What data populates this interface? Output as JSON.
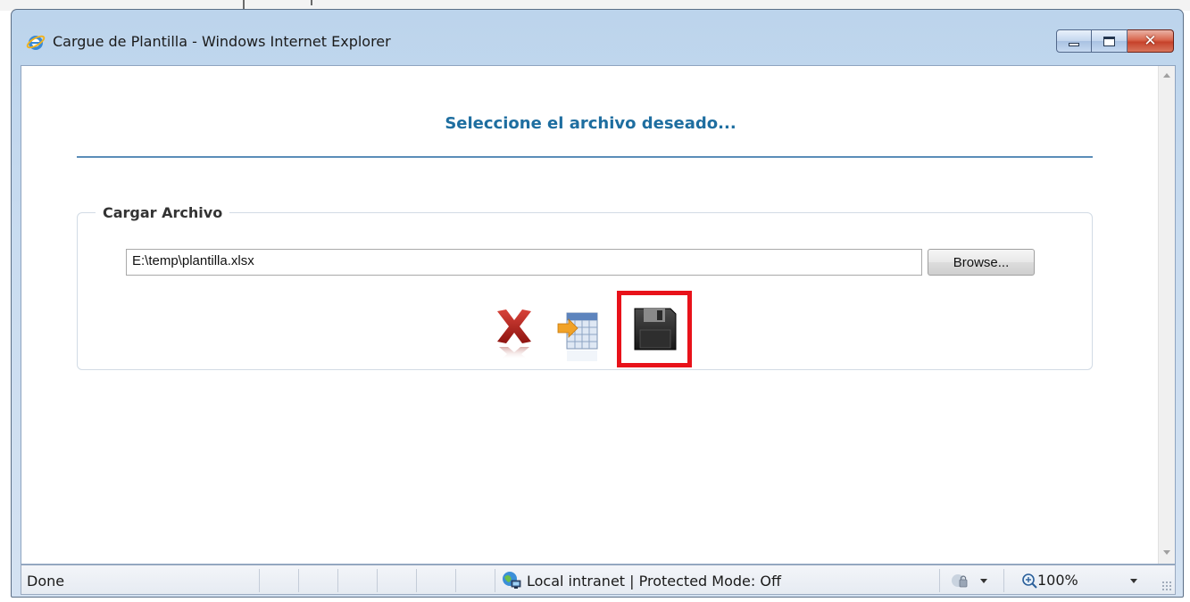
{
  "window": {
    "title": "Cargue de Plantilla - Windows Internet Explorer",
    "close_glyph": "✕"
  },
  "page": {
    "heading": "Seleccione el archivo deseado...",
    "upload_section": {
      "legend": "Cargar Archivo",
      "file_path_value": "E:\\temp\\plantilla.xlsx",
      "browse_label": "Browse..."
    },
    "actions": [
      {
        "name": "cancel",
        "icon": "red-x-icon"
      },
      {
        "name": "load-table",
        "icon": "table-arrow-icon"
      },
      {
        "name": "save",
        "icon": "floppy-disk-icon",
        "highlighted": true
      }
    ],
    "highlight_color": "#e8121a"
  },
  "statusbar": {
    "status": "Done",
    "zone": "Local intranet | Protected Mode: Off",
    "zoom": "100%"
  },
  "colors": {
    "heading": "#1e6ea0",
    "rule": "#5b8db8"
  }
}
